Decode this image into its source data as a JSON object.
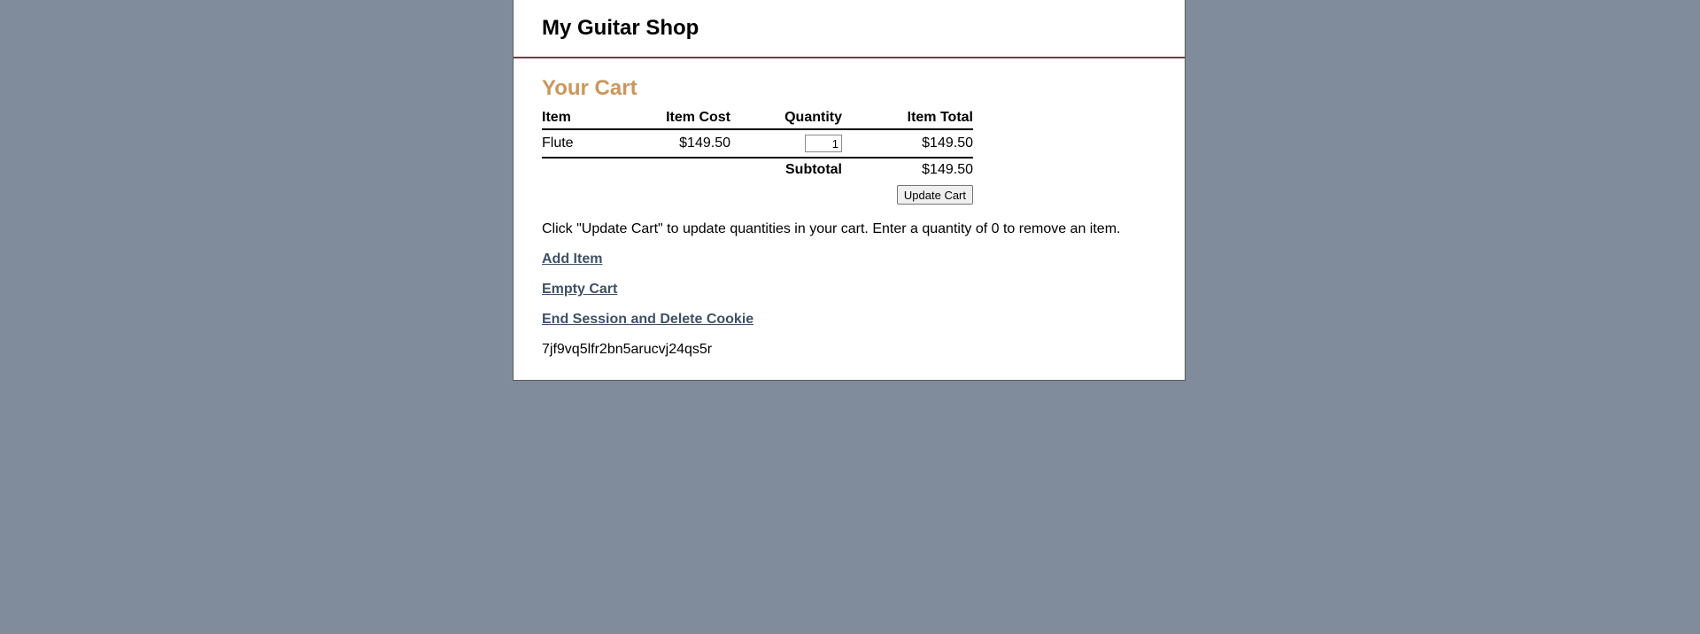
{
  "header": {
    "title": "My Guitar Shop"
  },
  "cart": {
    "heading": "Your Cart",
    "columns": {
      "item": "Item",
      "cost": "Item Cost",
      "quantity": "Quantity",
      "total": "Item Total"
    },
    "items": [
      {
        "name": "Flute",
        "cost": "$149.50",
        "quantity": "1",
        "total": "$149.50"
      }
    ],
    "subtotal_label": "Subtotal",
    "subtotal_value": "$149.50",
    "update_button": "Update Cart"
  },
  "instructions": "Click \"Update Cart\" to update quantities in your cart. Enter a quantity of 0 to remove an item.",
  "links": {
    "add_item": "Add Item",
    "empty_cart": "Empty Cart",
    "end_session": "End Session and Delete Cookie"
  },
  "session_id": "7jf9vq5lfr2bn5arucvj24qs5r",
  "colors": {
    "background": "#808c9c",
    "heading_accent": "#c9975e",
    "link": "#3f5165",
    "header_rule": "#7a3a48"
  }
}
